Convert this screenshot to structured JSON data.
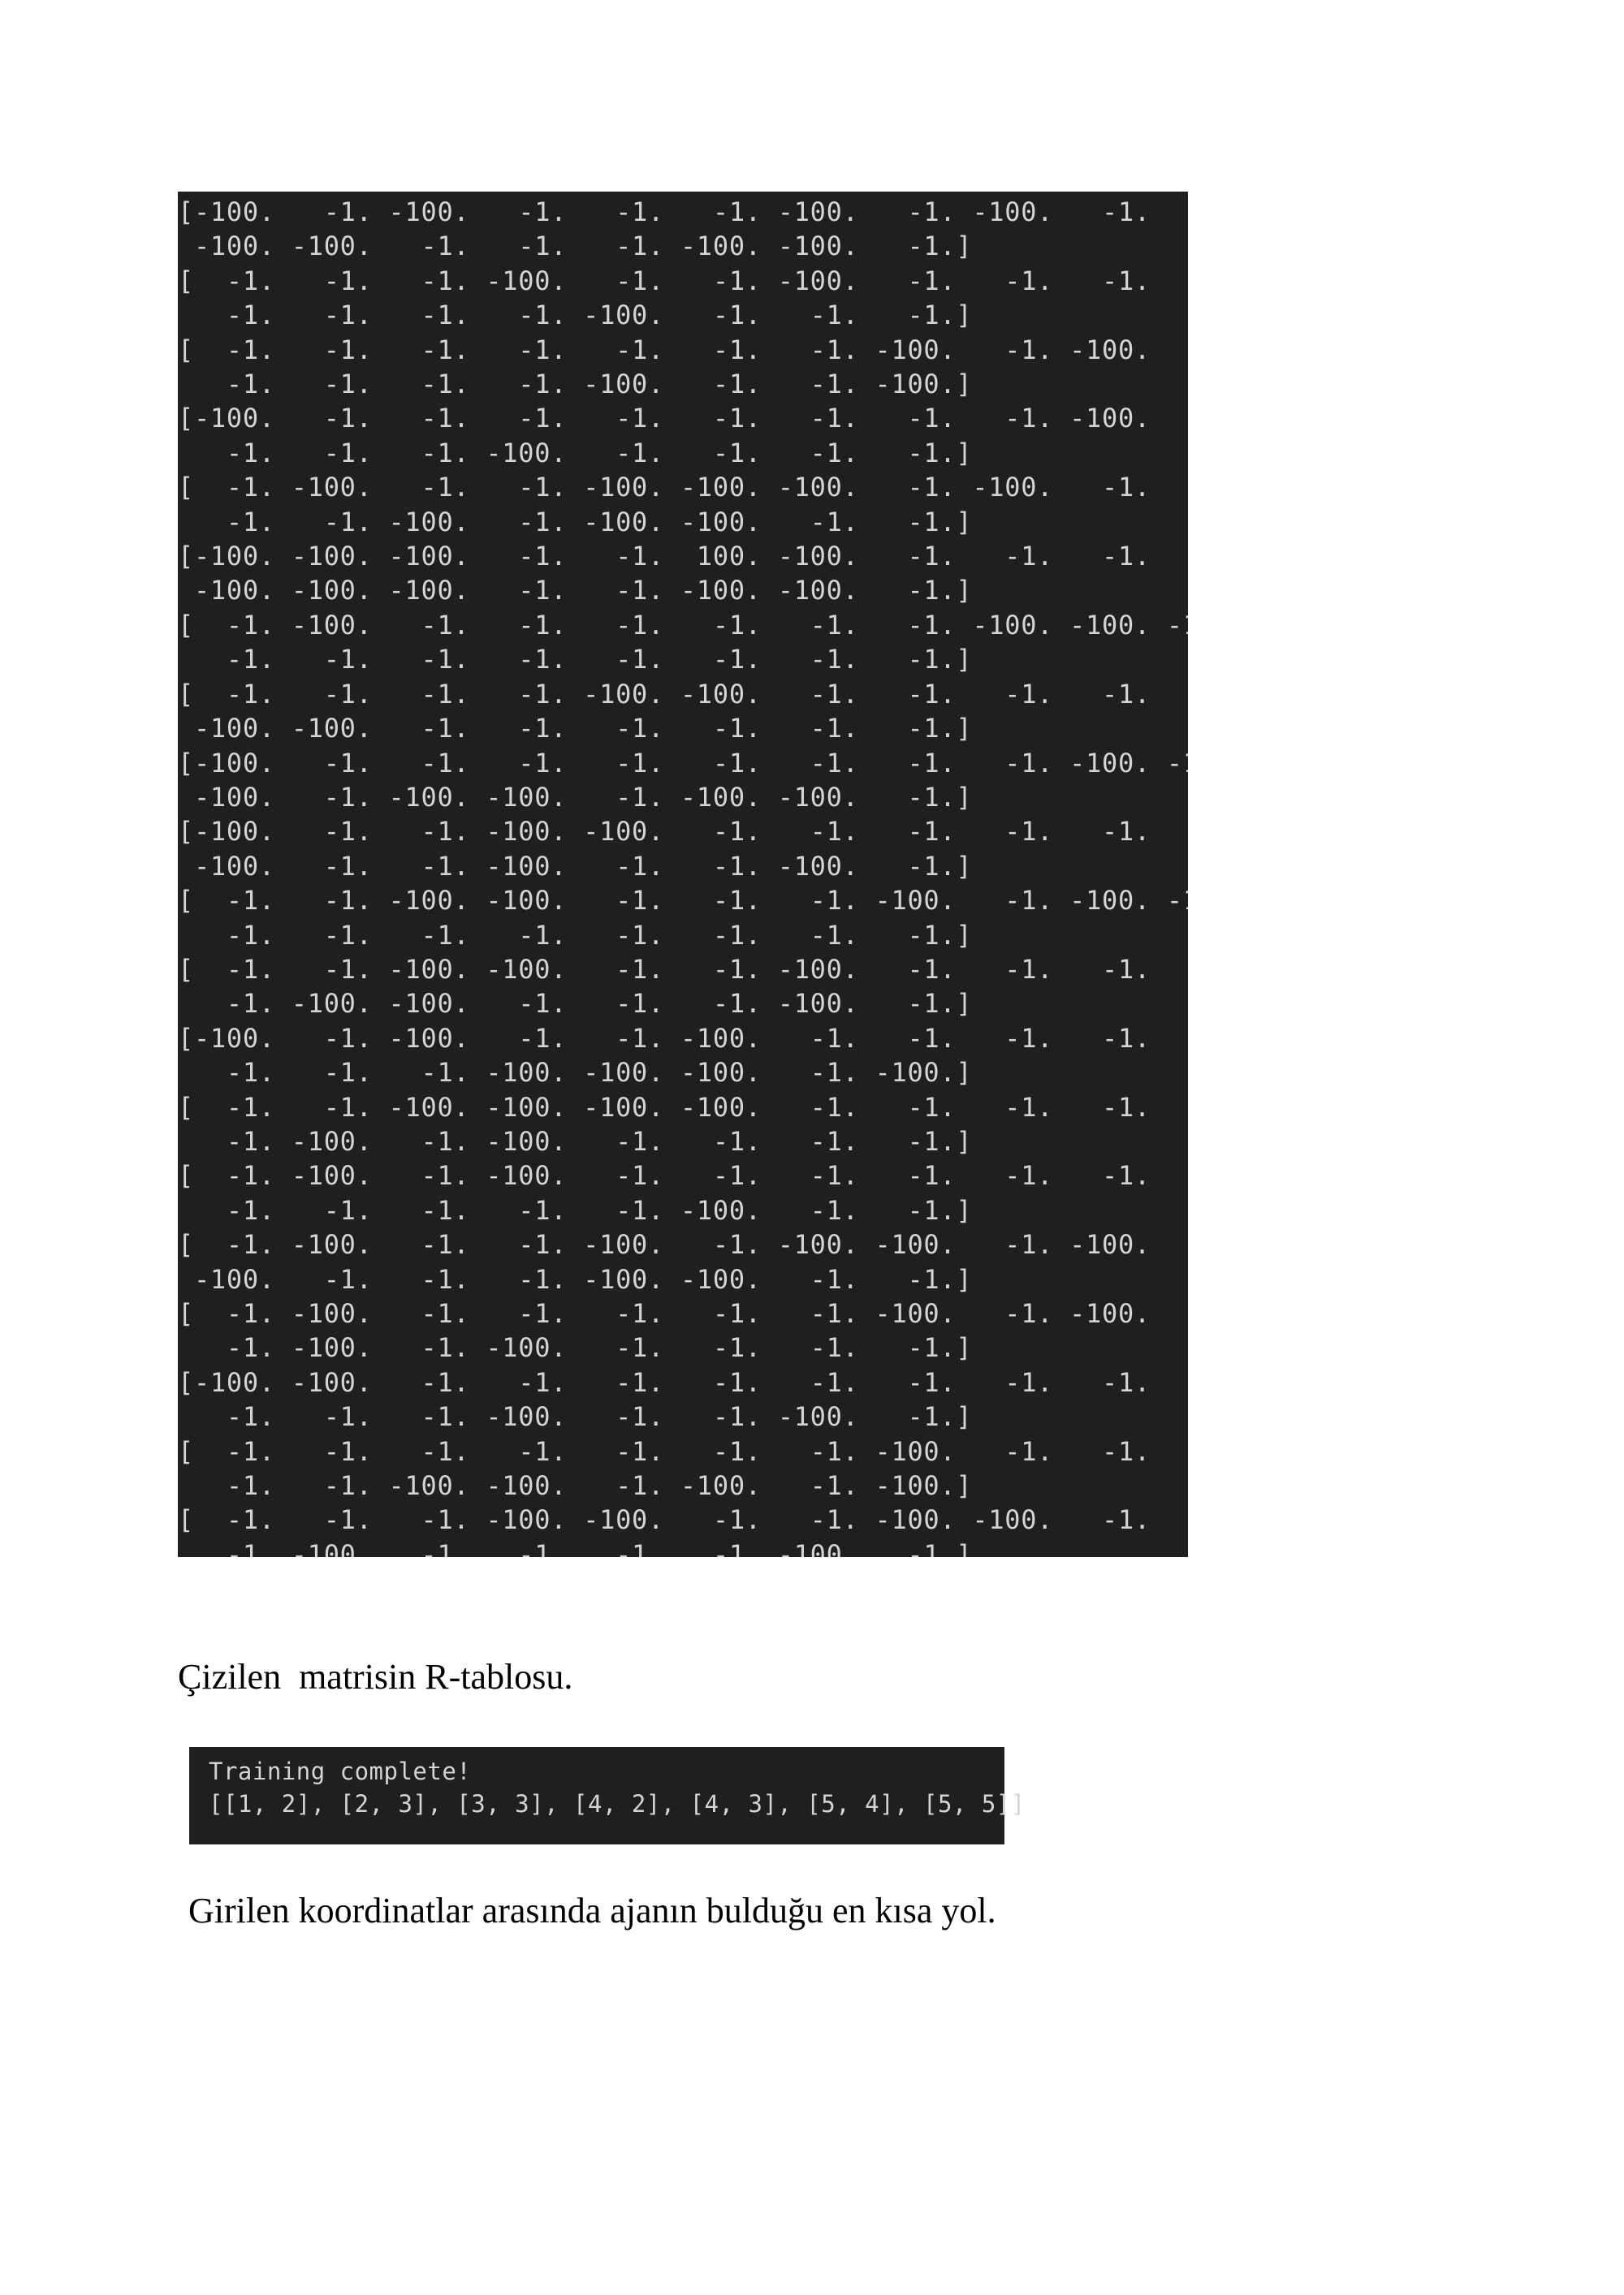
{
  "r_table_output": "[-100.   -1. -100.   -1.   -1.   -1. -100.   -1. -100.   -1.   -1.   -1.\n -100. -100.   -1.   -1.   -1. -100. -100.   -1.]\n[  -1.   -1.   -1. -100.   -1.   -1. -100.   -1.   -1.   -1.   -1.   -1.\n   -1.   -1.   -1.   -1. -100.   -1.   -1.   -1.]\n[  -1.   -1.   -1.   -1.   -1.   -1.   -1. -100.   -1. -100.   -1. -100.\n   -1.   -1.   -1.   -1. -100.   -1.   -1. -100.]\n[-100.   -1.   -1.   -1.   -1.   -1.   -1.   -1.   -1. -100.   -1. -100.\n   -1.   -1.   -1. -100.   -1.   -1.   -1.   -1.]\n[  -1. -100.   -1.   -1. -100. -100. -100.   -1. -100.   -1.   -1. -100.\n   -1.   -1. -100.   -1. -100. -100.   -1.   -1.]\n[-100. -100. -100.   -1.   -1.  100. -100.   -1.   -1.   -1.   -1. -100.\n -100. -100. -100.   -1.   -1. -100. -100.   -1.]\n[  -1. -100.   -1.   -1.   -1.   -1.   -1.   -1. -100. -100. -100. -100.\n   -1.   -1.   -1.   -1.   -1.   -1.   -1.   -1.]\n[  -1.   -1.   -1.   -1. -100. -100.   -1.   -1.   -1.   -1.   -1. -100.\n -100. -100.   -1.   -1.   -1.   -1.   -1.   -1.]\n[-100.   -1.   -1.   -1.   -1.   -1.   -1.   -1.   -1. -100. -100.   -1.\n -100.   -1. -100. -100.   -1. -100. -100.   -1.]\n[-100.   -1.   -1. -100. -100.   -1.   -1.   -1.   -1.   -1.   -1. -100.\n -100.   -1.   -1. -100.   -1.   -1. -100.   -1.]\n[  -1.   -1. -100. -100.   -1.   -1.   -1. -100.   -1. -100. -100.   -1.\n   -1.   -1.   -1.   -1.   -1.   -1.   -1.   -1.]\n[  -1.   -1. -100. -100.   -1.   -1. -100.   -1.   -1.   -1.   -1.   -1.\n   -1. -100. -100.   -1.   -1.   -1. -100.   -1.]\n[-100.   -1. -100.   -1.   -1. -100.   -1.   -1.   -1.   -1.   -1.   -1.\n   -1.   -1.   -1. -100. -100. -100.   -1. -100.]\n[  -1.   -1. -100. -100. -100. -100.   -1.   -1.   -1.   -1.   -1.   -1.\n   -1. -100.   -1. -100.   -1.   -1.   -1.   -1.]\n[  -1. -100.   -1. -100.   -1.   -1.   -1.   -1.   -1.   -1.   -1.   -1.\n   -1.   -1.   -1.   -1.   -1. -100.   -1.   -1.]\n[  -1. -100.   -1.   -1. -100.   -1. -100. -100.   -1. -100.   -1.   -1.\n -100.   -1.   -1.   -1. -100. -100.   -1.   -1.]\n[  -1. -100.   -1.   -1.   -1.   -1.   -1. -100.   -1. -100.   -1.   -1.\n   -1. -100.   -1. -100.   -1.   -1.   -1.   -1.]\n[-100. -100.   -1.   -1.   -1.   -1.   -1.   -1.   -1.   -1.   -1. -100.\n   -1.   -1.   -1. -100.   -1.   -1. -100.   -1.]\n[  -1.   -1.   -1.   -1.   -1.   -1.   -1. -100.   -1.   -1.   -1.   -1.\n   -1.   -1. -100. -100.   -1. -100.   -1. -100.]\n[  -1.   -1.   -1. -100. -100.   -1.   -1. -100. -100.   -1.   -1.   -1.\n   -1. -100.   -1.   -1.   -1.   -1. -100.   -1.]",
  "caption_r_table": "Çizilen  matrisin R-tablosu.",
  "training_output": "Training complete!\n[[1, 2], [2, 3], [3, 3], [4, 2], [4, 3], [5, 4], [5, 5]]",
  "caption_path": "Girilen koordinatlar arasında ajanın bulduğu en kısa yol."
}
